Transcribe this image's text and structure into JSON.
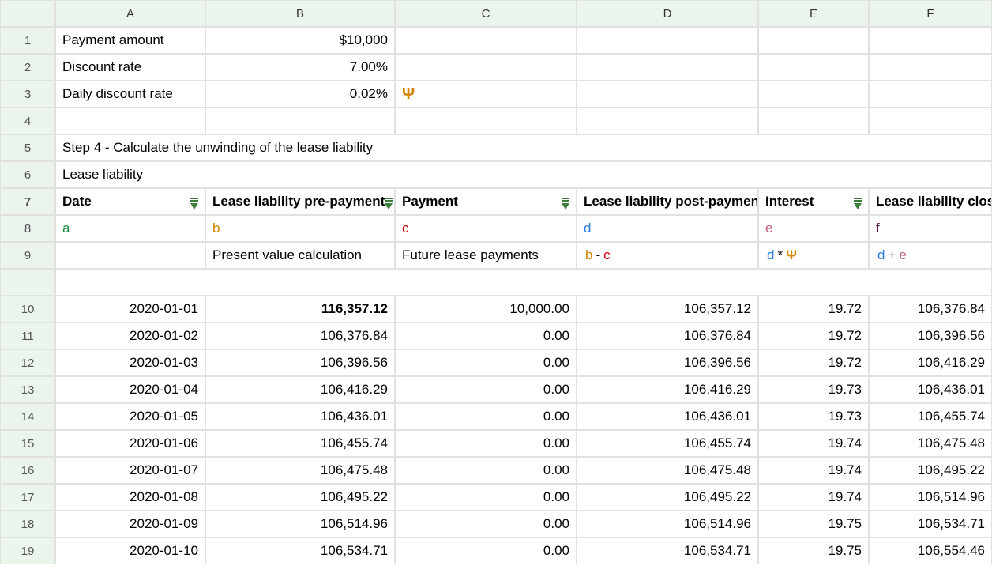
{
  "columns": [
    "A",
    "B",
    "C",
    "D",
    "E",
    "F"
  ],
  "rownums": [
    "1",
    "2",
    "3",
    "4",
    "5",
    "6",
    "7",
    "8",
    "9",
    "10",
    "11",
    "12",
    "13",
    "14",
    "15",
    "16",
    "17",
    "18",
    "19"
  ],
  "inputs": {
    "payment_label": "Payment amount",
    "payment_value": "$10,000",
    "discount_label": "Discount rate",
    "discount_value": "7.00%",
    "daily_discount_label": "Daily discount rate",
    "daily_discount_value": "0.02%",
    "psi_symbol": "Ψ"
  },
  "banner_step4": "Step 4 - Calculate the unwinding of the lease liability",
  "banner_lease": "Lease liability",
  "headers": {
    "date": "Date",
    "pre": "Lease liability pre-payment",
    "payment": "Payment",
    "post": "Lease liability post-payment",
    "interest": "Interest",
    "closing": "Lease liability closing"
  },
  "letters": {
    "a": "a",
    "b": "b",
    "c": "c",
    "d": "d",
    "e": "e",
    "f": "f"
  },
  "legend": {
    "b": "Present value calculation",
    "c": "Future lease payments",
    "d_parts": {
      "b": "b",
      "dash": " - ",
      "c": "c"
    },
    "e_parts": {
      "d": "d",
      "star": " * ",
      "psi": "Ψ"
    },
    "f_parts": {
      "d": "d",
      "plus": "  + ",
      "e": "e"
    }
  },
  "chart_data": {
    "type": "table",
    "columns": [
      "Date",
      "Lease liability pre-payment",
      "Payment",
      "Lease liability post-payment",
      "Interest",
      "Lease liability closing"
    ],
    "rows": [
      [
        "2020-01-01",
        "116,357.12",
        "10,000.00",
        "106,357.12",
        "19.72",
        "106,376.84"
      ],
      [
        "2020-01-02",
        "106,376.84",
        "0.00",
        "106,376.84",
        "19.72",
        "106,396.56"
      ],
      [
        "2020-01-03",
        "106,396.56",
        "0.00",
        "106,396.56",
        "19.72",
        "106,416.29"
      ],
      [
        "2020-01-04",
        "106,416.29",
        "0.00",
        "106,416.29",
        "19.73",
        "106,436.01"
      ],
      [
        "2020-01-05",
        "106,436.01",
        "0.00",
        "106,436.01",
        "19.73",
        "106,455.74"
      ],
      [
        "2020-01-06",
        "106,455.74",
        "0.00",
        "106,455.74",
        "19.74",
        "106,475.48"
      ],
      [
        "2020-01-07",
        "106,475.48",
        "0.00",
        "106,475.48",
        "19.74",
        "106,495.22"
      ],
      [
        "2020-01-08",
        "106,495.22",
        "0.00",
        "106,495.22",
        "19.74",
        "106,514.96"
      ],
      [
        "2020-01-09",
        "106,514.96",
        "0.00",
        "106,514.96",
        "19.75",
        "106,534.71"
      ],
      [
        "2020-01-10",
        "106,534.71",
        "0.00",
        "106,534.71",
        "19.75",
        "106,554.46"
      ]
    ]
  }
}
